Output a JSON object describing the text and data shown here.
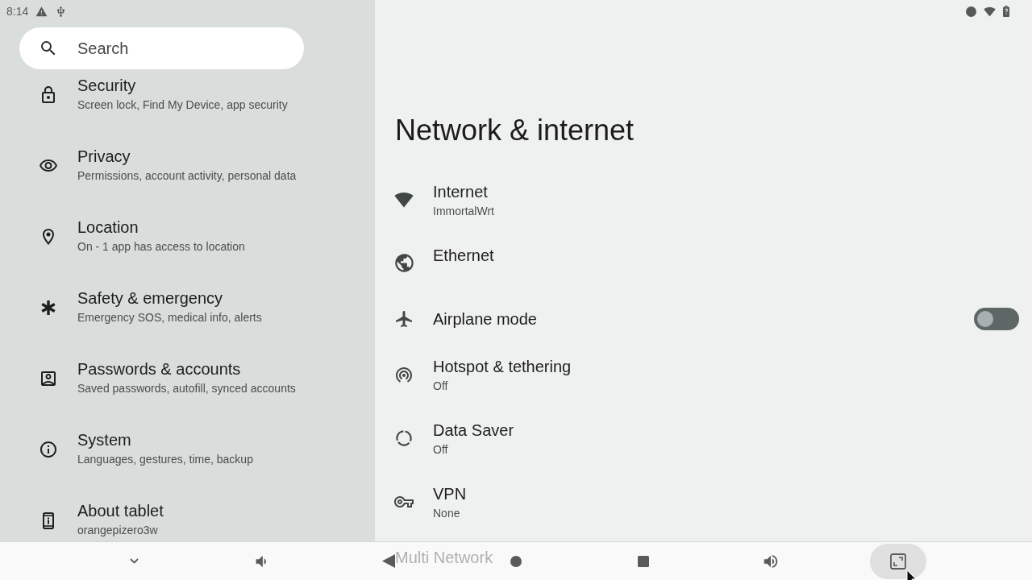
{
  "status_bar": {
    "time": "8:14"
  },
  "search": {
    "placeholder": "Search"
  },
  "sidebar": {
    "items": [
      {
        "title": "Security",
        "summary": "Screen lock, Find My Device, app security"
      },
      {
        "title": "Privacy",
        "summary": "Permissions, account activity, personal data"
      },
      {
        "title": "Location",
        "summary": "On - 1 app has access to location"
      },
      {
        "title": "Safety & emergency",
        "summary": "Emergency SOS, medical info, alerts"
      },
      {
        "title": "Passwords & accounts",
        "summary": "Saved passwords, autofill, synced accounts"
      },
      {
        "title": "System",
        "summary": "Languages, gestures, time, backup"
      },
      {
        "title": "About tablet",
        "summary": "orangepizero3w"
      }
    ]
  },
  "page": {
    "title": "Network & internet",
    "items": [
      {
        "kind": "link",
        "title": "Internet",
        "summary": "ImmortalWrt"
      },
      {
        "kind": "link",
        "title": "Ethernet"
      },
      {
        "kind": "switch",
        "title": "Airplane mode",
        "on": false
      },
      {
        "kind": "link",
        "title": "Hotspot & tethering",
        "summary": "Off"
      },
      {
        "kind": "link",
        "title": "Data Saver",
        "summary": "Off"
      },
      {
        "kind": "link",
        "title": "VPN",
        "summary": "None"
      },
      {
        "kind": "link",
        "title": "Multi Network"
      }
    ]
  },
  "nav_bar": {
    "buttons": [
      {
        "highlighted": false
      },
      {
        "highlighted": false
      },
      {
        "highlighted": false
      },
      {
        "highlighted": false
      },
      {
        "highlighted": false
      },
      {
        "highlighted": false
      },
      {
        "highlighted": true
      }
    ]
  }
}
